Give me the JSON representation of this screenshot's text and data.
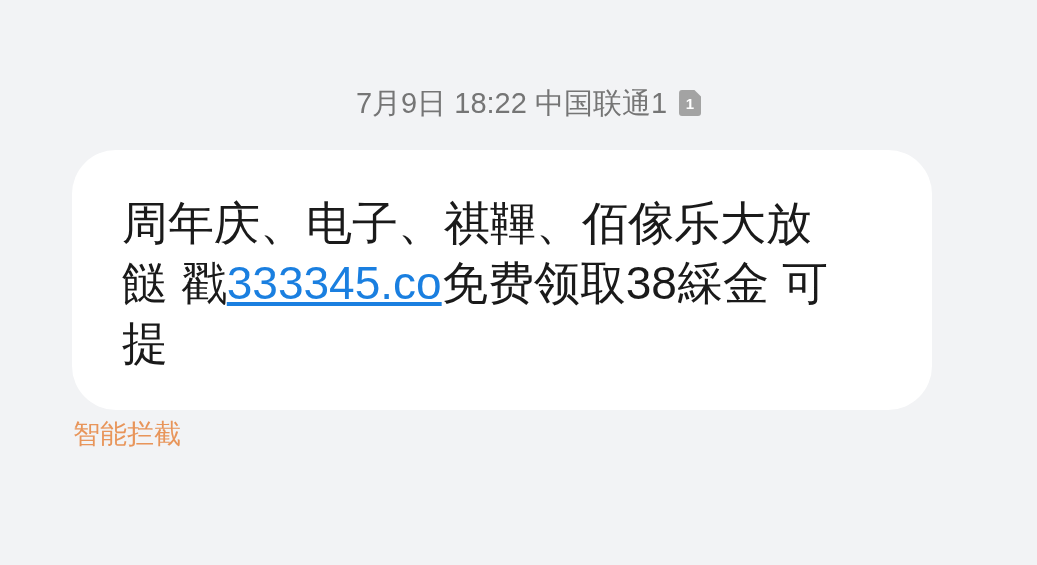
{
  "header": {
    "timestamp": "7月9日 18:22 中国联通1",
    "sim_badge": "1"
  },
  "message": {
    "text_before": "周年庆、电子、祺鞸、佰傢乐大放餸 戳",
    "link": "333345.co",
    "text_after": "免费领取38綵金 可提"
  },
  "filter_label": "智能拦截"
}
